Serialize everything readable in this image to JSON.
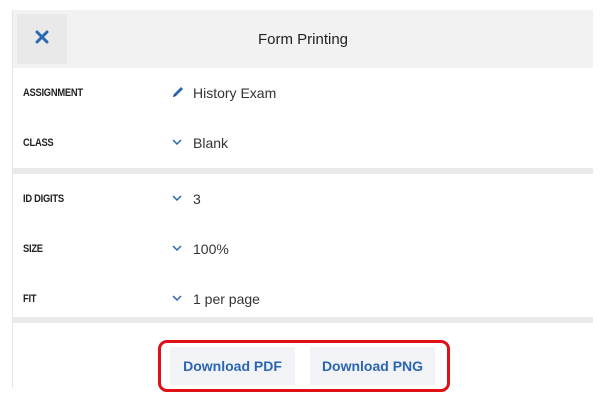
{
  "header": {
    "title": "Form Printing",
    "close_icon": "close-icon"
  },
  "fields": [
    {
      "label": "ASSIGNMENT",
      "value": "History Exam",
      "icon": "pencil-icon"
    },
    {
      "label": "CLASS",
      "value": "Blank",
      "icon": "chevron-down-icon"
    },
    {
      "label": "ID DIGITS",
      "value": "3",
      "icon": "chevron-down-icon"
    },
    {
      "label": "SIZE",
      "value": "100%",
      "icon": "chevron-down-icon"
    },
    {
      "label": "FIT",
      "value": "1 per page",
      "icon": "chevron-down-icon"
    }
  ],
  "footer": {
    "download_pdf": "Download PDF",
    "download_png": "Download PNG"
  },
  "colors": {
    "accent": "#2b66b3",
    "highlight": "#e10f16",
    "header_bg": "#f2f2f2"
  }
}
